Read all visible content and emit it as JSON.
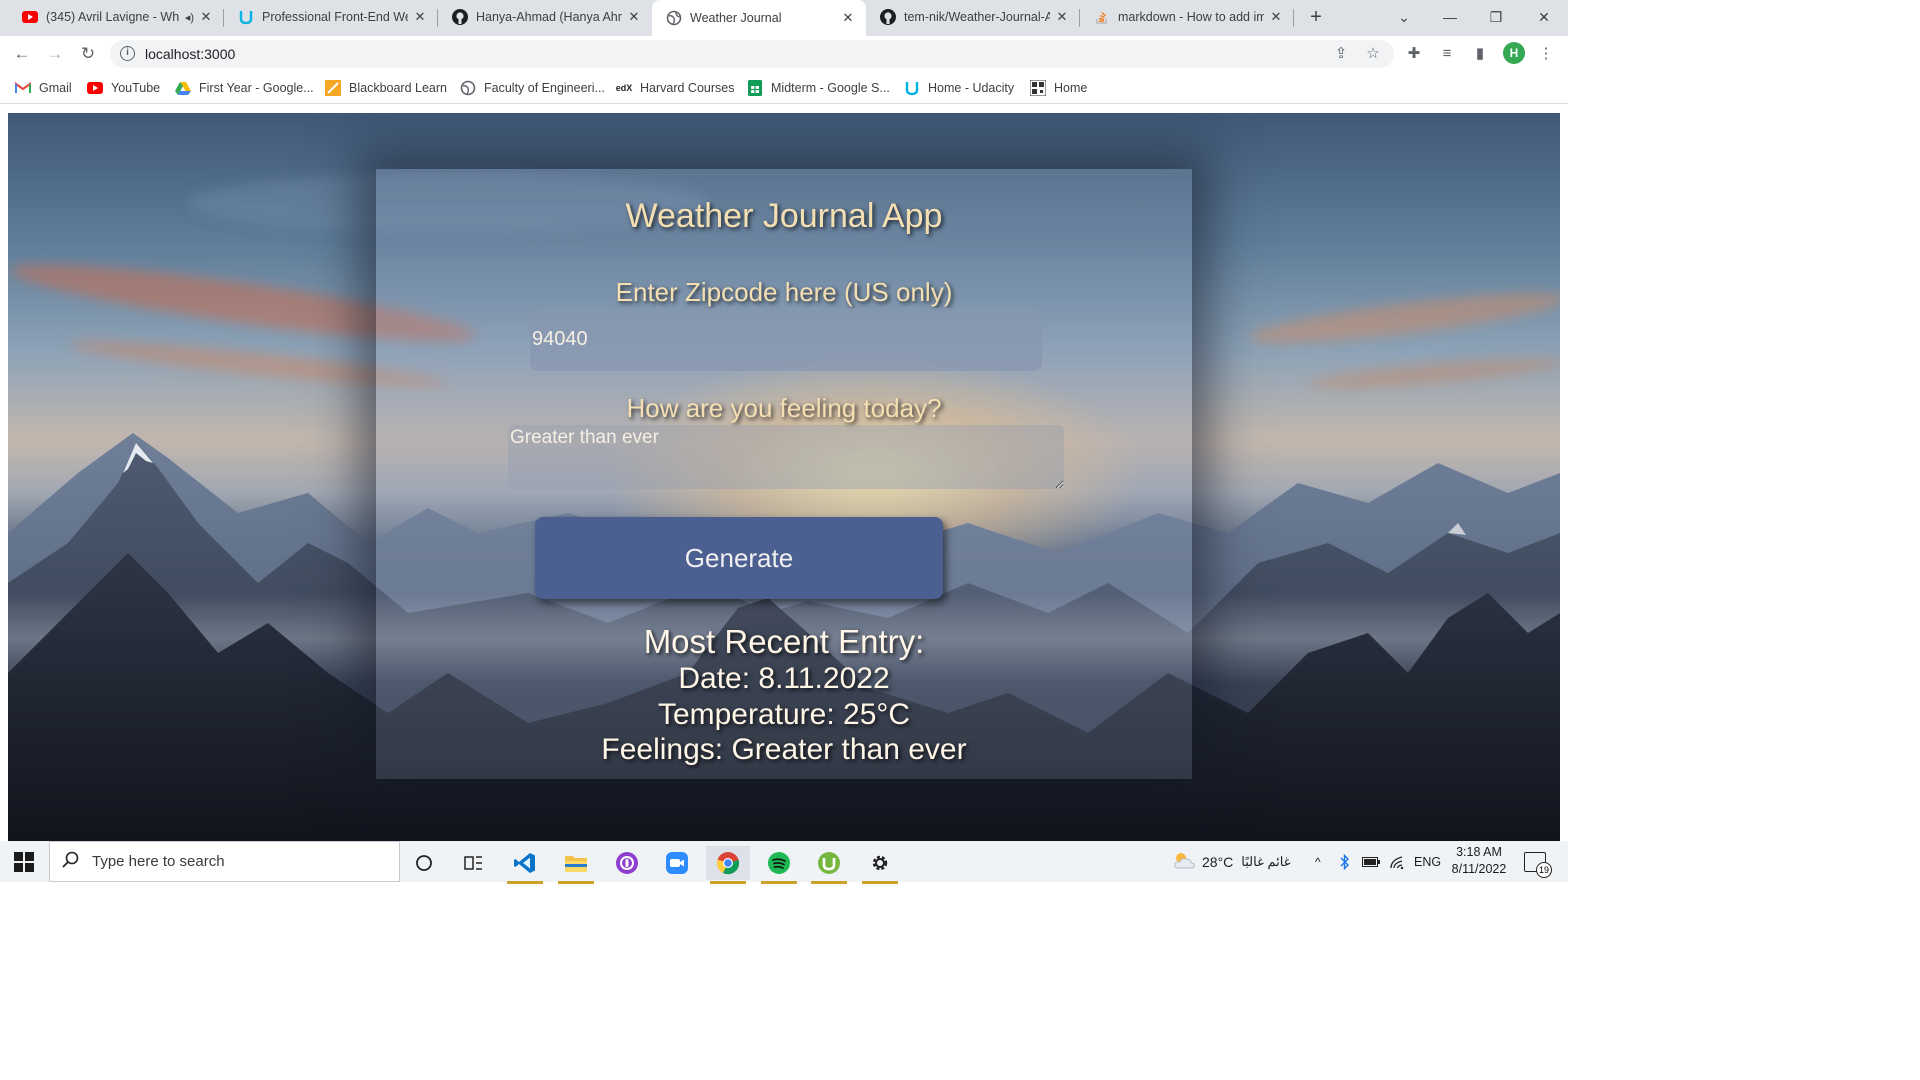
{
  "browser": {
    "tabs": [
      {
        "title": "(345) Avril Lavigne - Wh",
        "favicon": "youtube-icon",
        "audio": true
      },
      {
        "title": "Professional Front-End Web",
        "favicon": "udacity-icon"
      },
      {
        "title": "Hanya-Ahmad (Hanya Ahmad)",
        "favicon": "github-icon"
      },
      {
        "title": "Weather Journal",
        "favicon": "globe-icon",
        "active": true
      },
      {
        "title": "tem-nik/Weather-Journal-A",
        "favicon": "github-icon"
      },
      {
        "title": "markdown - How to add im",
        "favicon": "stackoverflow-icon"
      }
    ],
    "url": "localhost:3000",
    "profile_initial": "H",
    "bookmarks": [
      {
        "label": "Gmail",
        "icon": "gmail-icon"
      },
      {
        "label": "YouTube",
        "icon": "youtube-icon"
      },
      {
        "label": "First Year - Google...",
        "icon": "google-drive-icon"
      },
      {
        "label": "Blackboard Learn",
        "icon": "blackboard-icon"
      },
      {
        "label": "Faculty of Engineeri...",
        "icon": "globe-icon"
      },
      {
        "label": "Harvard Courses",
        "icon": "edx-icon"
      },
      {
        "label": "Midterm - Google S...",
        "icon": "google-sheets-icon"
      },
      {
        "label": "Home - Udacity",
        "icon": "udacity-icon"
      },
      {
        "label": "Home",
        "icon": "qr-icon"
      }
    ]
  },
  "app": {
    "title": "Weather Journal App",
    "zip_label": "Enter Zipcode here (US only)",
    "zip_value": "94040",
    "feelings_label": "How are you feeling today?",
    "feelings_value": "Greater than ever",
    "generate_label": "Generate",
    "entry": {
      "title": "Most Recent Entry:",
      "date": "Date: 8.11.2022",
      "temperature": "Temperature: 25°C",
      "feelings": "Feelings: Greater than ever"
    }
  },
  "taskbar": {
    "search_placeholder": "Type here to search",
    "apps": [
      "cortana-icon",
      "task-view-icon",
      "vscode-icon",
      "file-explorer-icon",
      "podcast-icon",
      "zoom-icon",
      "chrome-icon",
      "spotify-icon",
      "utorrent-icon",
      "settings-icon"
    ],
    "weather_temp": "28°C",
    "weather_text": "غائم غالبًا",
    "language": "ENG",
    "time": "3:18 AM",
    "date": "8/11/2022",
    "notifications": "19"
  },
  "colors": {
    "title_text": "#f4dfb3",
    "button": "#4c5f91",
    "chrome_frame": "#dee1e6"
  }
}
